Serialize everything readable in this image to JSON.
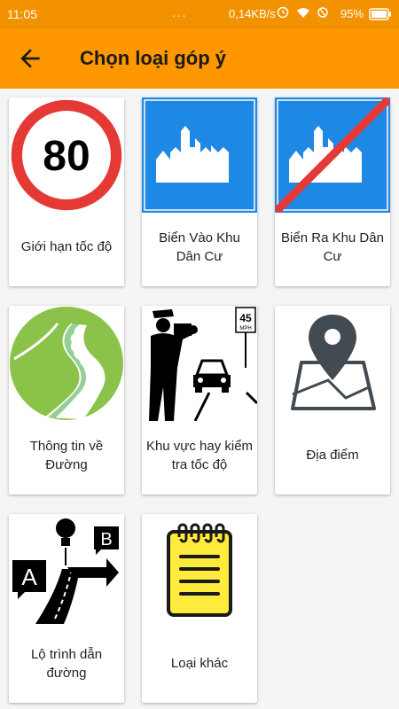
{
  "status_bar": {
    "time": "11:05",
    "dots": "...",
    "network_speed": "0,14KB/s",
    "battery_percent": "95%"
  },
  "app_bar": {
    "title": "Chọn loại góp ý",
    "back_icon": "arrow-back-icon"
  },
  "colors": {
    "status_bar": "#f39200",
    "app_bar": "#ff9800",
    "sign_blue": "#1e88e5",
    "sign_red": "#e53935",
    "road_green": "#8bc34a"
  },
  "categories": [
    {
      "label": "Giới hạn tốc độ",
      "icon": "speed-limit-80-icon",
      "sign_text": "80"
    },
    {
      "label": "Biển Vào Khu Dân Cư",
      "icon": "residential-area-sign-icon"
    },
    {
      "label": "Biển Ra Khu Dân Cư",
      "icon": "end-residential-area-sign-icon"
    },
    {
      "label": "Thông tin về Đường",
      "icon": "road-info-icon"
    },
    {
      "label": "Khu vực hay kiểm tra tốc độ",
      "icon": "speed-check-icon",
      "sign_text": "45",
      "sign_unit": "MPH"
    },
    {
      "label": "Địa điểm",
      "icon": "location-map-icon"
    },
    {
      "label": "Lộ trình dẫn đường",
      "icon": "navigation-route-icon",
      "letter_a": "A",
      "letter_b": "B"
    },
    {
      "label": "Loại khác",
      "icon": "notepad-icon"
    }
  ]
}
